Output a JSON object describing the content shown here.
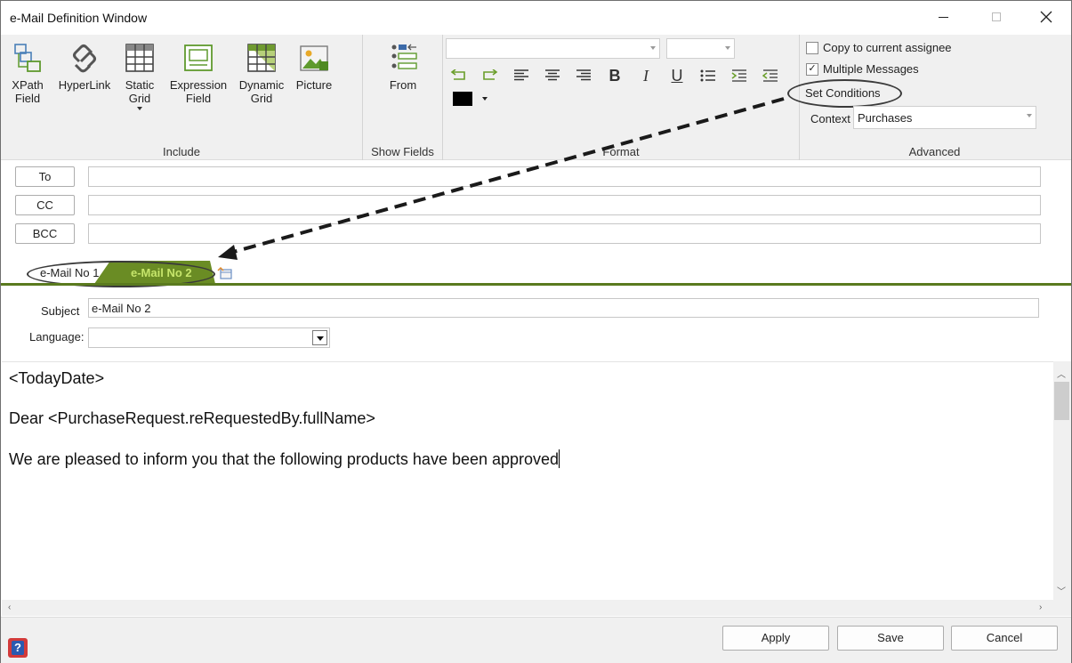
{
  "window": {
    "title": "e-Mail Definition Window",
    "controls": [
      "minimize",
      "maximize",
      "close"
    ]
  },
  "ribbon": {
    "include": {
      "label": "Include",
      "buttons": [
        {
          "label": "XPath\nField",
          "line1": "XPath",
          "line2": "Field",
          "icon": "xpath-field-icon"
        },
        {
          "label": "HyperLink",
          "icon": "hyperlink-icon"
        },
        {
          "line1": "Static",
          "line2": "Grid",
          "icon": "static-grid-icon",
          "has_dropdown": true
        },
        {
          "line1": "Expression",
          "line2": "Field",
          "icon": "expression-field-icon"
        },
        {
          "line1": "Dynamic",
          "line2": "Grid",
          "icon": "dynamic-grid-icon"
        },
        {
          "label": "Picture",
          "icon": "picture-icon"
        }
      ]
    },
    "show_fields": {
      "label": "Show Fields",
      "from_label": "From"
    },
    "format": {
      "label": "Format",
      "font_name": "",
      "font_size": "",
      "tools": [
        "undo-icon",
        "redo-icon",
        "align-left-icon",
        "align-center-icon",
        "align-right-icon",
        "bold-icon",
        "italic-icon",
        "underline-icon",
        "bullet-list-icon",
        "indent-icon",
        "outdent-icon"
      ],
      "bold_glyph": "B",
      "italic_glyph": "I",
      "underline_glyph": "U",
      "text_color": "#000000"
    },
    "advanced": {
      "label": "Advanced",
      "copy_to_assignee": {
        "label": "Copy to current assignee",
        "checked": false
      },
      "multiple_messages": {
        "label": "Multiple Messages",
        "checked": true
      },
      "set_conditions_label": "Set Conditions",
      "context_label": "Context",
      "context_value": "Purchases"
    }
  },
  "recipients": {
    "to_label": "To",
    "cc_label": "CC",
    "bcc_label": "BCC",
    "to_value": "",
    "cc_value": "",
    "bcc_value": ""
  },
  "tabs": [
    {
      "label": "e-Mail No  1",
      "active": false
    },
    {
      "label": "e-Mail No  2",
      "active": true
    }
  ],
  "message": {
    "subject_label": "Subject",
    "subject_value": "e-Mail No  2",
    "language_label": "Language:",
    "language_value": "",
    "body_lines": [
      "<TodayDate>",
      "Dear <PurchaseRequest.reRequestedBy.fullName>",
      "We are pleased to inform you that the following products have been approved"
    ]
  },
  "footer": {
    "apply_label": "Apply",
    "save_label": "Save",
    "cancel_label": "Cancel"
  },
  "colors": {
    "tab_active": "#6a8c24",
    "tab_line": "#5a7a1e",
    "tab_active_text": "#c6e56b"
  }
}
